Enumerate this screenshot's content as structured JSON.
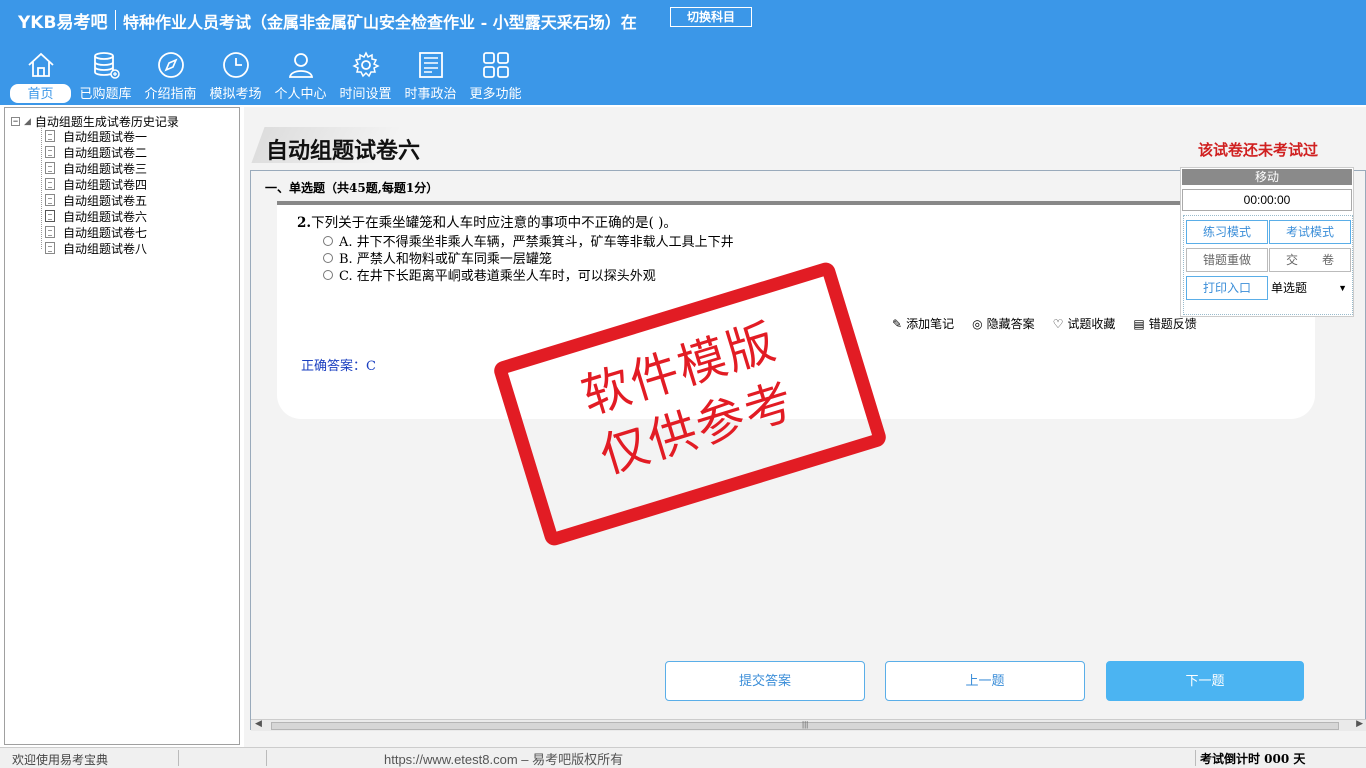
{
  "header": {
    "brand": "YKB易考吧",
    "title": "特种作业人员考试（金属非金属矿山安全检查作业 - 小型露天采石场）在",
    "switch_label": "切换科目"
  },
  "nav": [
    {
      "label": "首页",
      "icon": "home-icon"
    },
    {
      "label": "已购题库",
      "icon": "database-icon"
    },
    {
      "label": "介绍指南",
      "icon": "compass-icon"
    },
    {
      "label": "模拟考场",
      "icon": "clock-icon"
    },
    {
      "label": "个人中心",
      "icon": "user-icon"
    },
    {
      "label": "时间设置",
      "icon": "gear-icon"
    },
    {
      "label": "时事政治",
      "icon": "newspaper-icon"
    },
    {
      "label": "更多功能",
      "icon": "grid-icon"
    }
  ],
  "sidebar": {
    "root_label": "自动组题生成试卷历史记录",
    "items": [
      "自动组题试卷一",
      "自动组题试卷二",
      "自动组题试卷三",
      "自动组题试卷四",
      "自动组题试卷五",
      "自动组题试卷六",
      "自动组题试卷七",
      "自动组题试卷八"
    ]
  },
  "main": {
    "paper_title": "自动组题试卷六",
    "not_taken": "该试卷还未考试过",
    "section_heading": "一、单选题（共45题,每题1分）",
    "question": {
      "number": "2.",
      "text": "下列关于在乘坐罐笼和人车时应注意的事项中不正确的是( )。",
      "options": [
        "A. 井下不得乘坐非乘人车辆，严禁乘箕斗，矿车等非载人工具上下井",
        "B. 严禁人和物料或矿车同乘一层罐笼",
        "C. 在井下长距离平峒或巷道乘坐人车时，可以探头外观"
      ],
      "answer": "正确答案：C"
    },
    "tools": [
      "添加笔记",
      "隐藏答案",
      "试题收藏",
      "错题反馈"
    ],
    "buttons": {
      "submit": "提交答案",
      "prev": "上一题",
      "next": "下一题"
    }
  },
  "float_panel": {
    "move": "移动",
    "timer": "00:00:00",
    "practice_mode": "练习模式",
    "exam_mode": "考试模式",
    "redo_wrong": "错题重做",
    "hand_in": "交　　卷",
    "print": "打印入口",
    "type_select": "单选题"
  },
  "watermark": {
    "line1": "软件模版",
    "line2": "仅供参考"
  },
  "status": {
    "welcome": "欢迎使用易考宝典",
    "url": "https://www.etest8.com – 易考吧版权所有",
    "countdown": "考试倒计时 000 天"
  }
}
